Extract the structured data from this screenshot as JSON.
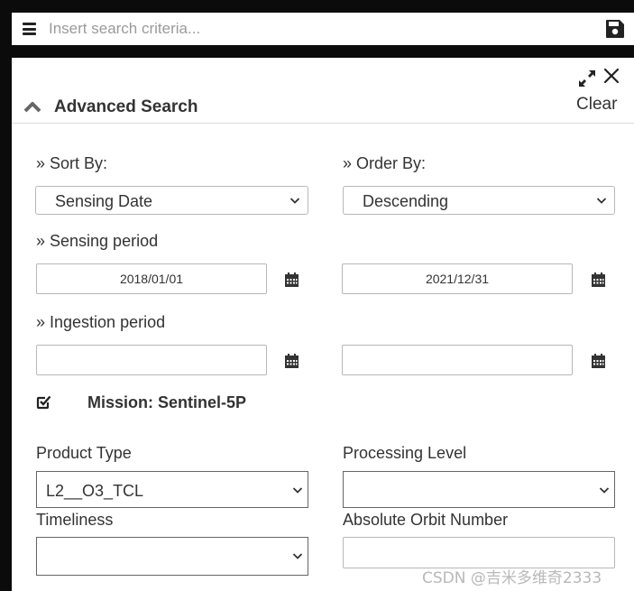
{
  "header": {
    "search_placeholder": "Insert search criteria..."
  },
  "panel": {
    "title": "Advanced Search",
    "clear_label": "Clear",
    "sort_by_label": "» Sort By:",
    "sort_by_value": "Sensing Date",
    "order_by_label": "» Order By:",
    "order_by_value": "Descending",
    "sensing_period_label": "» Sensing period",
    "sensing_start": "2018/01/01",
    "sensing_end": "2021/12/31",
    "ingestion_period_label": "» Ingestion period",
    "ingestion_start": "",
    "ingestion_end": "",
    "mission_label": "Mission: Sentinel-5P",
    "product_type_label": "Product Type",
    "product_type_value": "L2__O3_TCL",
    "processing_level_label": "Processing Level",
    "processing_level_value": "",
    "timeliness_label": "Timeliness",
    "timeliness_value": "",
    "orbit_label": "Absolute Orbit Number",
    "orbit_value": ""
  },
  "watermark": "CSDN @吉米多维奇2333",
  "icons": [
    "menu-icon",
    "save-icon",
    "expand-icon",
    "close-icon",
    "chevron-up-icon",
    "calendar-icon",
    "checkbox-checked-icon",
    "chevron-down-icon"
  ]
}
